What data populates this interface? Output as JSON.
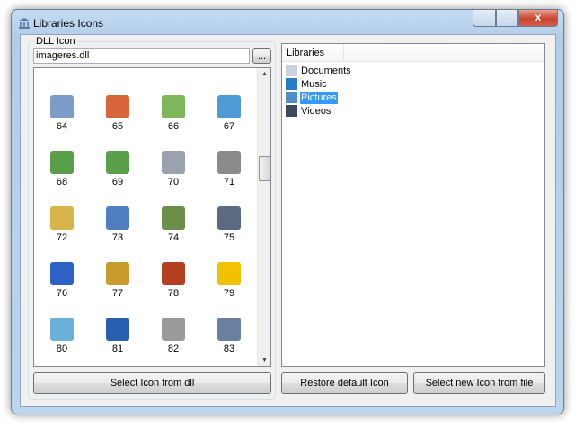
{
  "window": {
    "title": "Libraries Icons",
    "close_label": "x"
  },
  "left": {
    "group_label": "DLL Icon",
    "dll_path": "imageres.dll",
    "browse_label": "...",
    "icons": [
      {
        "n": "64",
        "icon": "gear-document-icon",
        "color": "#7a9cc7"
      },
      {
        "n": "65",
        "icon": "picture-house-icon",
        "color": "#d9663a"
      },
      {
        "n": "66",
        "icon": "picture-landscape-icon",
        "color": "#7cb85a"
      },
      {
        "n": "67",
        "icon": "picture-sky-icon",
        "color": "#4e9ad4"
      },
      {
        "n": "68",
        "icon": "network-user-icon",
        "color": "#5aa04a"
      },
      {
        "n": "69",
        "icon": "network-user-icon",
        "color": "#5aa04a"
      },
      {
        "n": "70",
        "icon": "drive-icon",
        "color": "#9aa3ad"
      },
      {
        "n": "71",
        "icon": "printer-icon",
        "color": "#8a8a8a"
      },
      {
        "n": "72",
        "icon": "folder-user-icon",
        "color": "#d8b54a"
      },
      {
        "n": "73",
        "icon": "shield-icon",
        "color": "#4f7fc0"
      },
      {
        "n": "74",
        "icon": "users-icon",
        "color": "#6b8f4a"
      },
      {
        "n": "75",
        "icon": "server-icon",
        "color": "#5a6a80"
      },
      {
        "n": "76",
        "icon": "info-icon",
        "color": "#2d62c4"
      },
      {
        "n": "77",
        "icon": "key-icon",
        "color": "#c99a2c"
      },
      {
        "n": "78",
        "icon": "photo-icon",
        "color": "#b34020"
      },
      {
        "n": "79",
        "icon": "warning-icon",
        "color": "#f2c200"
      },
      {
        "n": "80",
        "icon": "disc-icon",
        "color": "#6ab0d8"
      },
      {
        "n": "81",
        "icon": "sync-icon",
        "color": "#2a5fb0"
      },
      {
        "n": "82",
        "icon": "documents-icon",
        "color": "#9a9a9a"
      },
      {
        "n": "83",
        "icon": "users-icon",
        "color": "#6b7fa0"
      }
    ],
    "select_dll_label": "Select Icon from dll"
  },
  "right": {
    "column_header": "Libraries",
    "items": [
      {
        "label": "Documents",
        "icon": "documents-icon",
        "color": "#c8d3df"
      },
      {
        "label": "Music",
        "icon": "music-icon",
        "color": "#2a7ac4"
      },
      {
        "label": "Pictures",
        "icon": "pictures-icon",
        "color": "#4e8fc6"
      },
      {
        "label": "Videos",
        "icon": "videos-icon",
        "color": "#3a4a5a"
      }
    ],
    "selected": "Pictures",
    "restore_label": "Restore default Icon",
    "select_file_label": "Select new Icon from file"
  }
}
